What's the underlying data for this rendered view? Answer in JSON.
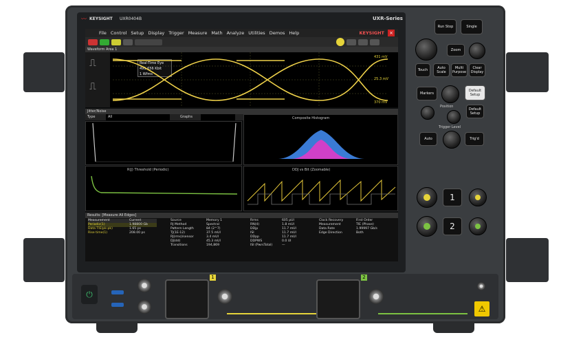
{
  "brand": "KEYSIGHT",
  "model": "UXR0404B",
  "series": "UXR-Series",
  "menu": [
    "File",
    "Control",
    "Setup",
    "Display",
    "Trigger",
    "Measure",
    "Math",
    "Analyze",
    "Utilities",
    "Demos",
    "Help"
  ],
  "top_right_brand": "KEYSIGHT",
  "waveform_area": {
    "title": "Waveform Area 1",
    "eye_label": [
      "Real-Time Eye",
      "491.656 Kbit",
      "1 Wfms"
    ],
    "right_scale": [
      "431 mV",
      "25.3 mV",
      "370 mV"
    ]
  },
  "jitter_noise": {
    "title": "Jitter/Noise",
    "type_label": "Type",
    "type_value": "All",
    "graphs_label": "Graphs"
  },
  "panels": {
    "composite_histogram": "Composite Histogram",
    "rj_threshold": "R(J) Threshold (Periodic)",
    "ddj_vs_bit": "DDJ vs Bit (Zoomable)"
  },
  "results": {
    "title": "Results: [Measure All Edges]",
    "col_measurement": "Measurement",
    "col_current": "Current",
    "rows": [
      {
        "name": "Periodic(1)",
        "value": "1.98800 Gb"
      },
      {
        "name": "Data TIE(pk-pk)",
        "value": "1.65 ps"
      },
      {
        "name": "Rise time(1)",
        "value": "208.00 ps"
      }
    ],
    "col2": [
      [
        "Source",
        "Memory 1"
      ],
      [
        "RJ Method",
        "Spectral"
      ],
      [
        "Pattern Length",
        "84 (2^7)"
      ],
      [
        "TJ(1E-12)",
        "37.5 mUI"
      ],
      [
        "RJ(rms)/sensor",
        "3.4 mUI"
      ],
      [
        "DJ(dd)",
        "45.3 mUI"
      ],
      [
        "Transitions",
        "194,869"
      ]
    ],
    "col3": [
      [
        "Rrms",
        "605 pUI"
      ],
      [
        "RN(4)",
        "1.8 mUI"
      ],
      [
        "DDjp",
        "11.7 mUI"
      ],
      [
        "ISI",
        "11.7 mUI"
      ],
      [
        "DDpp",
        "11.7 mUI"
      ],
      [
        "DDPWS",
        "0.0 UI"
      ],
      [
        "ISI (PwrsTotal)",
        "—"
      ]
    ],
    "col4": [
      [
        "Clock Recovery",
        "First Order"
      ],
      [
        "Measurement",
        "TIE (Phase)"
      ],
      [
        "Data Rate",
        "1.99997 Gb/s"
      ],
      [
        "Edge Direction",
        "Both"
      ]
    ]
  },
  "front_panel": {
    "keys": {
      "run_stop": "Run Stop",
      "single": "Single",
      "zoom": "Zoom",
      "touch": "Touch",
      "auto_scale": "Auto Scale",
      "multi_purpose": "Multi Purpose",
      "clear_display": "Clear Display",
      "markers": "Markers",
      "position": "Position",
      "default_setup": "Default Setup",
      "auto": "Auto",
      "trig_level": "Trigger Level",
      "trig_d": "Trig'd"
    },
    "channels": [
      "1",
      "2"
    ]
  },
  "input_labels": [
    "1",
    "2"
  ],
  "colors": {
    "eye": "#f0d24a",
    "channel": "#e6d43a",
    "green_trace": "#7cc242",
    "histogram_blue": "#3a7bd5",
    "histogram_magenta": "#d040c8",
    "power_led": "#3cb86a"
  }
}
